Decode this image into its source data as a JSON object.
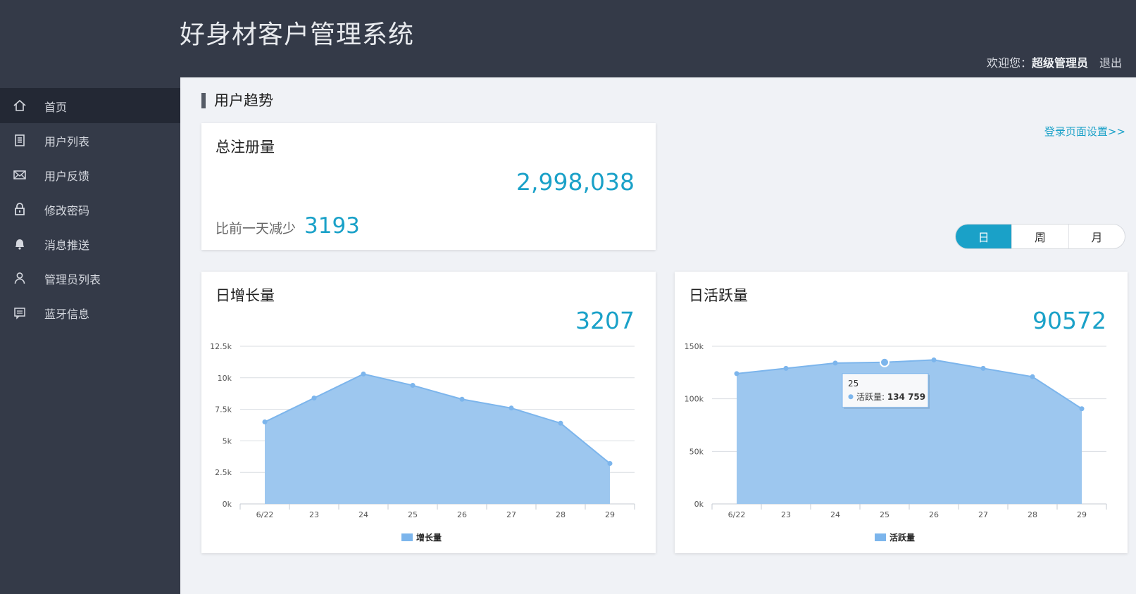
{
  "header": {
    "title": "好身材客户管理系统",
    "welcome_prefix": "欢迎您：",
    "username": "超级管理员",
    "logout": "退出"
  },
  "sidebar": {
    "items": [
      {
        "label": "首页",
        "icon": "home-icon",
        "active": true
      },
      {
        "label": "用户列表",
        "icon": "clipboard-icon",
        "active": false
      },
      {
        "label": "用户反馈",
        "icon": "mail-icon",
        "active": false
      },
      {
        "label": "修改密码",
        "icon": "lock-icon",
        "active": false
      },
      {
        "label": "消息推送",
        "icon": "bell-icon",
        "active": false
      },
      {
        "label": "管理员列表",
        "icon": "user-icon",
        "active": false
      },
      {
        "label": "蓝牙信息",
        "icon": "message-icon",
        "active": false
      }
    ]
  },
  "main": {
    "section_title": "用户趋势",
    "settings_link": "登录页面设置>>",
    "total_card": {
      "title": "总注册量",
      "value": "2,998,038",
      "compare_label": "比前一天减少",
      "compare_value": "3193"
    },
    "period_toggle": {
      "options": [
        "日",
        "周",
        "月"
      ],
      "selected": "日"
    },
    "growth_card": {
      "title": "日增长量",
      "value": "3207"
    },
    "active_card": {
      "title": "日活跃量",
      "value": "90572"
    }
  },
  "colors": {
    "accent": "#1aa1c8",
    "area_fill": "#9dc7ef",
    "area_line": "#7cb5ec",
    "sidebar_bg": "#343a48",
    "sidebar_active": "#232834"
  },
  "chart_data": [
    {
      "type": "area",
      "x": [
        "6/22",
        "23",
        "24",
        "25",
        "26",
        "27",
        "28",
        "29"
      ],
      "series": [
        {
          "name": "增长量",
          "values": [
            6500,
            8400,
            10300,
            9400,
            8300,
            7600,
            6400,
            3207
          ]
        }
      ],
      "yticks": [
        "0k",
        "2.5k",
        "5k",
        "7.5k",
        "10k",
        "12.5k"
      ],
      "ylim": [
        0,
        12500
      ],
      "legend": "bottom-center",
      "grid": true
    },
    {
      "type": "area",
      "x": [
        "6/22",
        "23",
        "24",
        "25",
        "26",
        "27",
        "28",
        "29"
      ],
      "series": [
        {
          "name": "活跃量",
          "values": [
            124000,
            129000,
            134000,
            134759,
            137000,
            129000,
            121000,
            90572
          ]
        }
      ],
      "yticks": [
        "0k",
        "50k",
        "100k",
        "150k"
      ],
      "ylim": [
        0,
        150000
      ],
      "legend": "bottom-center",
      "grid": true,
      "tooltip": {
        "category": "25",
        "series": "活跃量",
        "value": "134 759"
      }
    }
  ]
}
